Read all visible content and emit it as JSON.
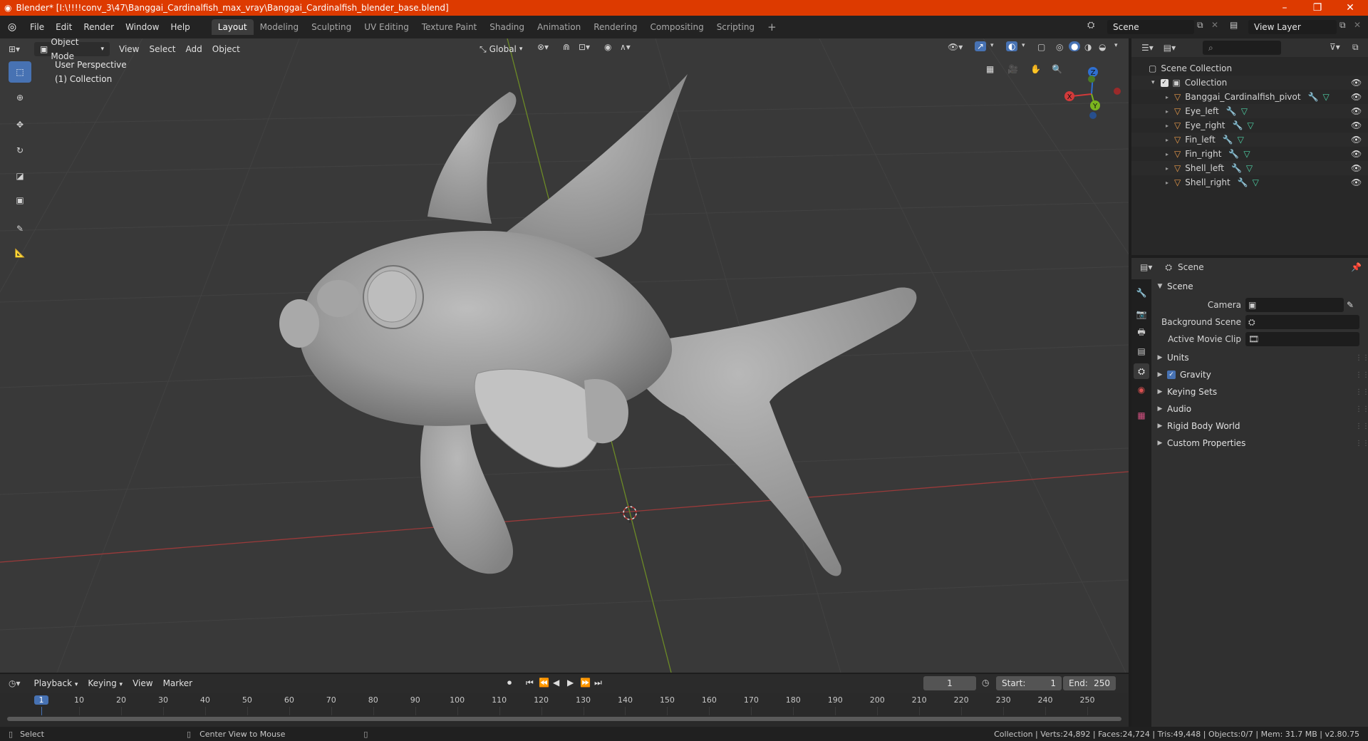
{
  "window": {
    "title": "Blender* [I:\\!!!!conv_3\\47\\Banggai_Cardinalfish_max_vray\\Banggai_Cardinalfish_blender_base.blend]",
    "minimize": "–",
    "maximize": "❐",
    "close": "✕"
  },
  "menu": [
    "File",
    "Edit",
    "Render",
    "Window",
    "Help"
  ],
  "workspaces": [
    "Layout",
    "Modeling",
    "Sculpting",
    "UV Editing",
    "Texture Paint",
    "Shading",
    "Animation",
    "Rendering",
    "Compositing",
    "Scripting"
  ],
  "workspace_add": "+",
  "scene_field": "Scene",
  "view_layer_field": "View Layer",
  "viewport": {
    "mode": "Object Mode",
    "menus": [
      "View",
      "Select",
      "Add",
      "Object"
    ],
    "orientation": "Global",
    "overlay_title": "User Perspective",
    "overlay_collection": "(1) Collection",
    "gizmo": {
      "x": "X",
      "y": "Y",
      "z": "Z"
    }
  },
  "outliner": {
    "search_placeholder": "",
    "root": "Scene Collection",
    "collection": "Collection",
    "objects": [
      "Banggai_Cardinalfish_pivot",
      "Eye_left",
      "Eye_right",
      "Fin_left",
      "Fin_right",
      "Shell_left",
      "Shell_right"
    ]
  },
  "properties": {
    "header": "Scene",
    "section": "Scene",
    "camera_label": "Camera",
    "background_label": "Background Scene",
    "movieclip_label": "Active Movie Clip",
    "sections": [
      "Units",
      "Gravity",
      "Keying Sets",
      "Audio",
      "Rigid Body World",
      "Custom Properties"
    ]
  },
  "timeline": {
    "menus": [
      "Playback",
      "Keying",
      "View",
      "Marker"
    ],
    "current_frame": "1",
    "start_label": "Start:",
    "start": "1",
    "end_label": "End:",
    "end": "250",
    "ticks": [
      "1",
      "10",
      "20",
      "30",
      "40",
      "50",
      "60",
      "70",
      "80",
      "90",
      "100",
      "110",
      "120",
      "130",
      "140",
      "150",
      "160",
      "170",
      "180",
      "190",
      "200",
      "210",
      "220",
      "230",
      "240",
      "250"
    ]
  },
  "status": {
    "select": "Select",
    "center_view": "Center View to Mouse",
    "stats": "Collection | Verts:24,892 | Faces:24,724 | Tris:49,448 | Objects:0/7 | Mem: 31.7 MB | v2.80.75"
  },
  "colors": {
    "accent": "#4772b3",
    "titlebar": "#dd3a00",
    "object": "#e89a4a",
    "modifier": "#6fa5ff",
    "mesh": "#4ed1a5"
  }
}
